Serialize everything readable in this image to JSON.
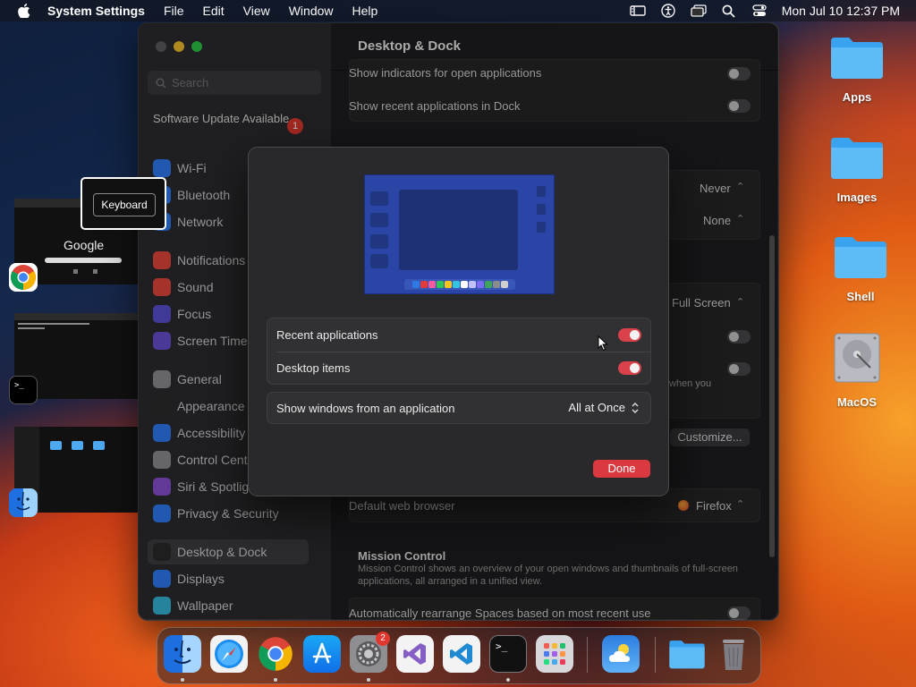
{
  "menubar": {
    "app_name": "System Settings",
    "menus": [
      "File",
      "Edit",
      "View",
      "Window",
      "Help"
    ],
    "clock": "Mon Jul 10  12:37 PM",
    "status_icons": [
      "screen-mirroring-icon",
      "accessibility-icon",
      "window-icon",
      "spotlight-icon",
      "control-center-icon"
    ]
  },
  "sidebar": {
    "search_placeholder": "Search",
    "software_update": "Software Update Available",
    "software_update_badge": "1",
    "items": [
      {
        "label": "Wi-Fi",
        "icon": "wifi-icon",
        "color": "#2f7cf6"
      },
      {
        "label": "Bluetooth",
        "icon": "bluetooth-icon",
        "color": "#2f7cf6"
      },
      {
        "label": "Network",
        "icon": "network-icon",
        "color": "#2f7cf6"
      },
      {
        "label": "Notifications",
        "icon": "notifications-icon",
        "color": "#e5463c"
      },
      {
        "label": "Sound",
        "icon": "sound-icon",
        "color": "#e5463c"
      },
      {
        "label": "Focus",
        "icon": "focus-icon",
        "color": "#5b4fd1"
      },
      {
        "label": "Screen Time",
        "icon": "screen-time-icon",
        "color": "#6a4fd1"
      },
      {
        "label": "General",
        "icon": "general-icon",
        "color": "#8e8e93"
      },
      {
        "label": "Appearance",
        "icon": "appearance-icon",
        "color": "#2a2a2a"
      },
      {
        "label": "Accessibility",
        "icon": "accessibility-icon",
        "color": "#2f7cf6"
      },
      {
        "label": "Control Cente",
        "icon": "control-center-icon",
        "color": "#8e8e93"
      },
      {
        "label": "Siri & Spotlig",
        "icon": "siri-icon",
        "color": "#8a4fd1"
      },
      {
        "label": "Privacy & Security",
        "icon": "privacy-icon",
        "color": "#2f7cf6"
      },
      {
        "label": "Desktop & Dock",
        "icon": "desktop-dock-icon",
        "color": "#2a2a2a"
      },
      {
        "label": "Displays",
        "icon": "displays-icon",
        "color": "#2f7cf6"
      },
      {
        "label": "Wallpaper",
        "icon": "wallpaper-icon",
        "color": "#35b6d8"
      }
    ]
  },
  "main": {
    "title": "Desktop & Dock",
    "rows": {
      "show_indicators": "Show indicators for open applications",
      "show_recent": "Show recent applications in Dock",
      "never": "Never",
      "none": "None",
      "full_screen": "Full Screen",
      "when_you": "when you",
      "customize": "Customize...",
      "default_browser": "Default web browser",
      "browser_value": "Firefox",
      "mission_control_title": "Mission Control",
      "mission_control_desc": "Mission Control shows an overview of your open windows and thumbnails of full-screen applications, all arranged in a unified view.",
      "auto_rearrange": "Automatically rearrange Spaces based on most recent use"
    }
  },
  "sheet": {
    "recent_applications": "Recent applications",
    "recent_applications_on": true,
    "desktop_items": "Desktop items",
    "desktop_items_on": true,
    "show_windows_label": "Show windows from an application",
    "show_windows_value": "All at Once",
    "done_label": "Done",
    "preview_dock_colors": [
      "#2c7be5",
      "#e23b3b",
      "#f45aa0",
      "#2ec45a",
      "#f5c518",
      "#35c5e0",
      "#ffffff",
      "#c0c0ff",
      "#7a6cf0",
      "#3da35d",
      "#8a8a8a",
      "#cfcfcf"
    ]
  },
  "tooltip": {
    "label": "Keyboard"
  },
  "stage_manager": {
    "google_logo": "Google",
    "apps": [
      "chrome-icon",
      "terminal-icon",
      "finder-icon"
    ]
  },
  "desktop_icons": [
    {
      "label": "Apps",
      "icon": "folder-icon"
    },
    {
      "label": "Images",
      "icon": "folder-icon"
    },
    {
      "label": "Shell",
      "icon": "folder-icon"
    },
    {
      "label": "MacOS",
      "icon": "hard-drive-icon"
    }
  ],
  "dock": {
    "apps": [
      {
        "name": "finder-icon",
        "running": true
      },
      {
        "name": "safari-icon",
        "running": false
      },
      {
        "name": "chrome-icon",
        "running": true
      },
      {
        "name": "app-store-icon",
        "running": false
      },
      {
        "name": "system-settings-icon",
        "running": true,
        "badge": "2"
      },
      {
        "name": "visual-studio-icon",
        "running": false
      },
      {
        "name": "vscode-icon",
        "running": false
      },
      {
        "name": "terminal-icon",
        "running": true
      },
      {
        "name": "launchpad-icon",
        "running": false
      },
      {
        "name": "weather-icon",
        "running": false
      },
      {
        "name": "downloads-folder-icon",
        "running": false
      },
      {
        "name": "trash-icon",
        "running": false
      }
    ]
  }
}
